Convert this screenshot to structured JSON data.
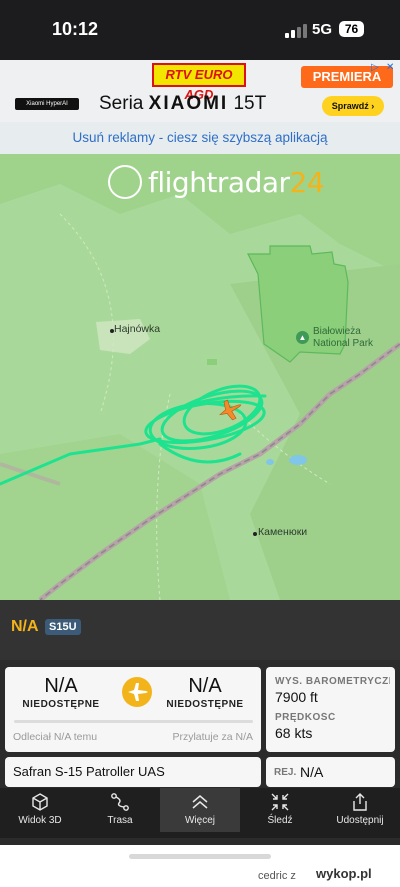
{
  "status_bar": {
    "time": "10:12",
    "network": "5G",
    "battery": "76"
  },
  "ad": {
    "rtv_text": "RTV EURO AGD",
    "premiera_text": "PREMIERA",
    "hyper_text": "Xiaomi HyperAI",
    "seria_prefix": "Seria",
    "seria_brand": "XIAOMI",
    "seria_model": "15T",
    "cta": "Sprawdź ›",
    "adchoice_symbol": "▷",
    "close_symbol": "✕"
  },
  "remove_ads": "Usuń reklamy - ciesz się szybszą aplikacją",
  "map": {
    "brand_text": "flightradar",
    "brand_num": "24",
    "labels": {
      "hajnowka": "Hajnówka",
      "park": "Białowieża",
      "park2": "National Park",
      "kamenyuki": "Каменюки"
    },
    "colors": {
      "track": "#1fe28f",
      "plane": "#f38a2b"
    }
  },
  "flight": {
    "id": "N/A",
    "callsign": "S15U"
  },
  "route": {
    "origin": "N/A",
    "origin_label": "NIEDOSTĘPNE",
    "destination": "N/A",
    "destination_label": "NIEDOSTĘPNE",
    "departed": "Odleciał N/A temu",
    "arrives": "Przylatuje za N/A"
  },
  "stats": {
    "altitude_label": "WYS. BAROMETRYCZNA",
    "altitude_value": "7900 ft",
    "speed_label": "PRĘDKOŚĆ",
    "speed_value": "68 kts"
  },
  "aircraft": {
    "type": "Safran S-15 Patroller UAS",
    "reg_label": "REJ.",
    "reg_value": "N/A"
  },
  "tabs": [
    {
      "label": "Widok 3D"
    },
    {
      "label": "Trasa"
    },
    {
      "label": "Więcej"
    },
    {
      "label": "Śledź"
    },
    {
      "label": "Udostępnij"
    }
  ],
  "credit": {
    "user": "cedric z",
    "site": "wykop.pl"
  }
}
